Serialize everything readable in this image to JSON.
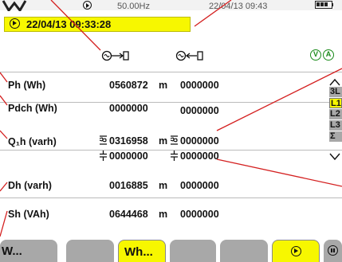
{
  "status": {
    "frequency": "50.00Hz",
    "datetime": "22/04/13  09:43"
  },
  "header": {
    "timestamp": "22/04/13  09:33:28"
  },
  "indicators": {
    "v": "V",
    "a": "A"
  },
  "rows": [
    {
      "label": "Ph (Wh)",
      "consumed": "0560872",
      "unit": "m",
      "generated": "0000000"
    },
    {
      "label": "Pdch (Wh)",
      "consumed": "0000000",
      "unit": "",
      "generated": "0000000"
    },
    {
      "label": "Q₁h (varh)",
      "consumed_inductive": "0316958",
      "consumed_capacitive": "0000000",
      "unit": "m",
      "generated_inductive": "0000000",
      "generated_capacitive": "0000000"
    },
    {
      "label": "Dh (varh)",
      "consumed": "0016885",
      "unit": "m",
      "generated": "0000000"
    },
    {
      "label": "Sh (VAh)",
      "consumed": "0644468",
      "unit": "m",
      "generated": "0000000"
    }
  ],
  "phase_selector": [
    "3L",
    "L1",
    "L2",
    "L3",
    "Σ"
  ],
  "tabs": [
    "W...",
    "Wh..."
  ],
  "colors": {
    "accent": "#f7f700",
    "tab_grey": "#a8a8a8",
    "indicator_green": "#1a8a1a"
  },
  "icons": {
    "consumed": "energy-consumed-icon",
    "generated": "energy-generated-icon",
    "inductive": "inductive-icon",
    "capacitive": "capacitive-icon"
  }
}
